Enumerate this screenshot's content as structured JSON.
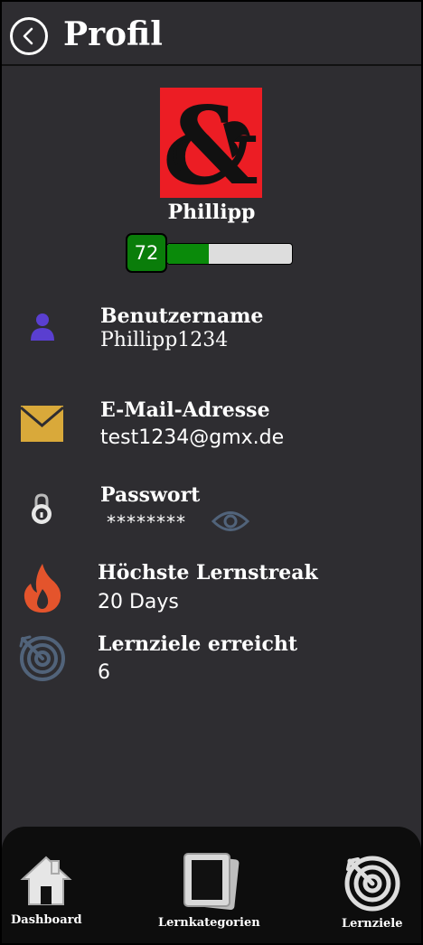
{
  "header": {
    "title": "Profil"
  },
  "profile": {
    "name": "Phillipp",
    "level": "72",
    "level_progress": 0.33
  },
  "fields": {
    "username": {
      "label": "Benutzername",
      "value": "Phillipp1234",
      "icon": "user-icon"
    },
    "email": {
      "label": "E-Mail-Adresse",
      "value": "test1234@gmx.de",
      "icon": "mail-icon"
    },
    "password": {
      "label": "Passwort",
      "value": "********",
      "icon": "lock-icon",
      "toggle_icon": "eye-icon"
    },
    "streak": {
      "label": "Höchste Lernstreak",
      "value": "20 Days",
      "icon": "flame-icon"
    },
    "goals": {
      "label": "Lernziele erreicht",
      "value": "6",
      "icon": "target-icon"
    }
  },
  "nav": {
    "items": [
      {
        "label": "Dashboard",
        "icon": "home-icon"
      },
      {
        "label": "Lernkategorien",
        "icon": "cards-icon"
      },
      {
        "label": "Lernziele",
        "icon": "target-icon"
      }
    ]
  },
  "colors": {
    "background": "#2e2d31",
    "accent_red": "#ec1d24",
    "level_green": "#0a7d0a",
    "user_purple": "#5a3fd0",
    "mail_gold": "#d9a93a",
    "flame_orange": "#e4542c"
  }
}
